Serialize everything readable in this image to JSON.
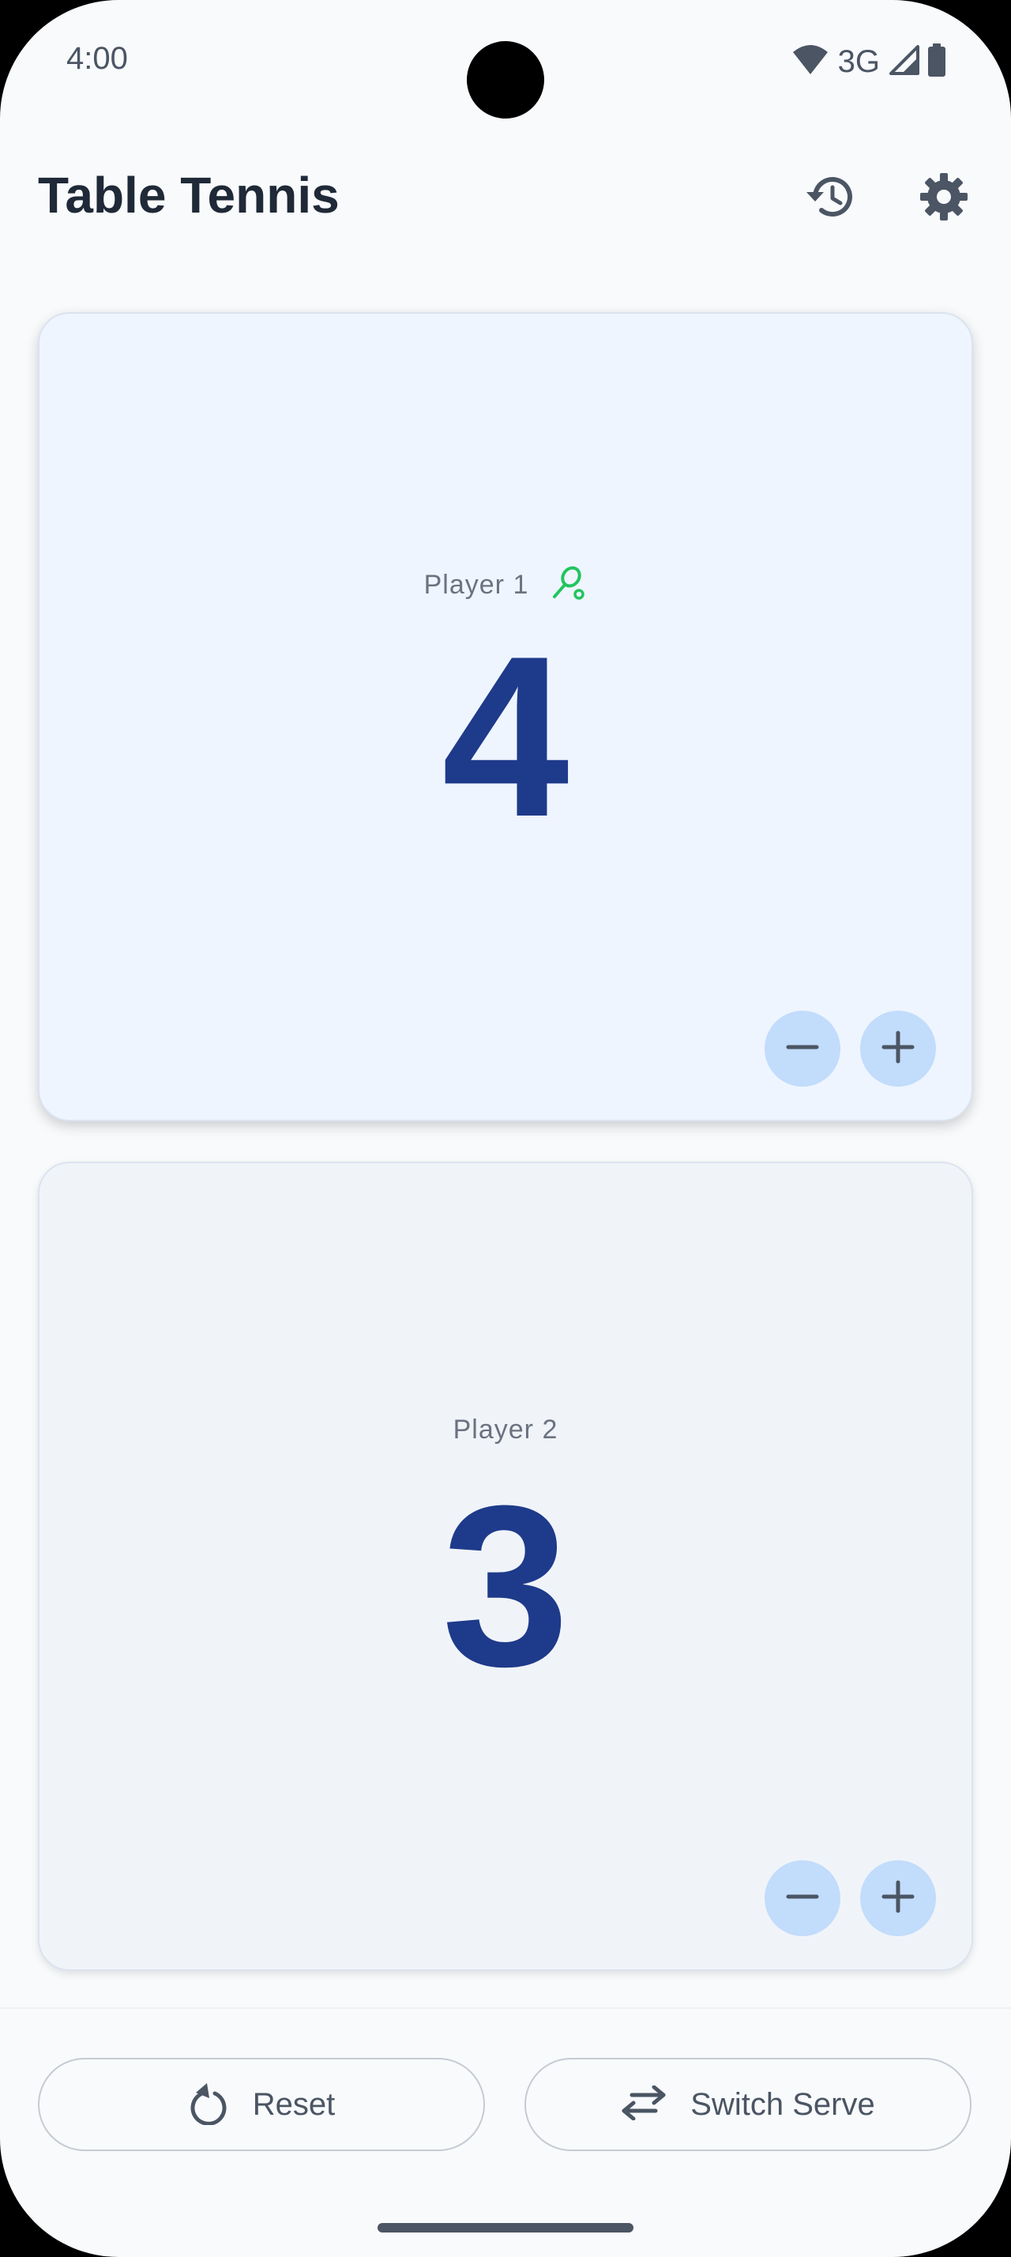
{
  "status_bar": {
    "time": "4:00",
    "network": "3G",
    "icons": [
      "wifi-icon",
      "cell-signal-icon",
      "battery-icon"
    ]
  },
  "app_bar": {
    "title": "Table Tennis",
    "actions": [
      "history-icon",
      "settings-gear-icon"
    ]
  },
  "players": [
    {
      "name": "Player 1",
      "score": "4",
      "serving": true,
      "serve_icon": "racket-icon"
    },
    {
      "name": "Player 2",
      "score": "3",
      "serving": false
    }
  ],
  "buttons": {
    "reset_label": "Reset",
    "switch_serve_label": "Switch Serve"
  },
  "colors": {
    "score": "#1e3a8a",
    "active_card": "#eef5ff",
    "inactive_card": "#f0f4f9",
    "score_button": "#c2dcfb",
    "serve_indicator": "#22c55e",
    "background": "#f8fafc"
  }
}
